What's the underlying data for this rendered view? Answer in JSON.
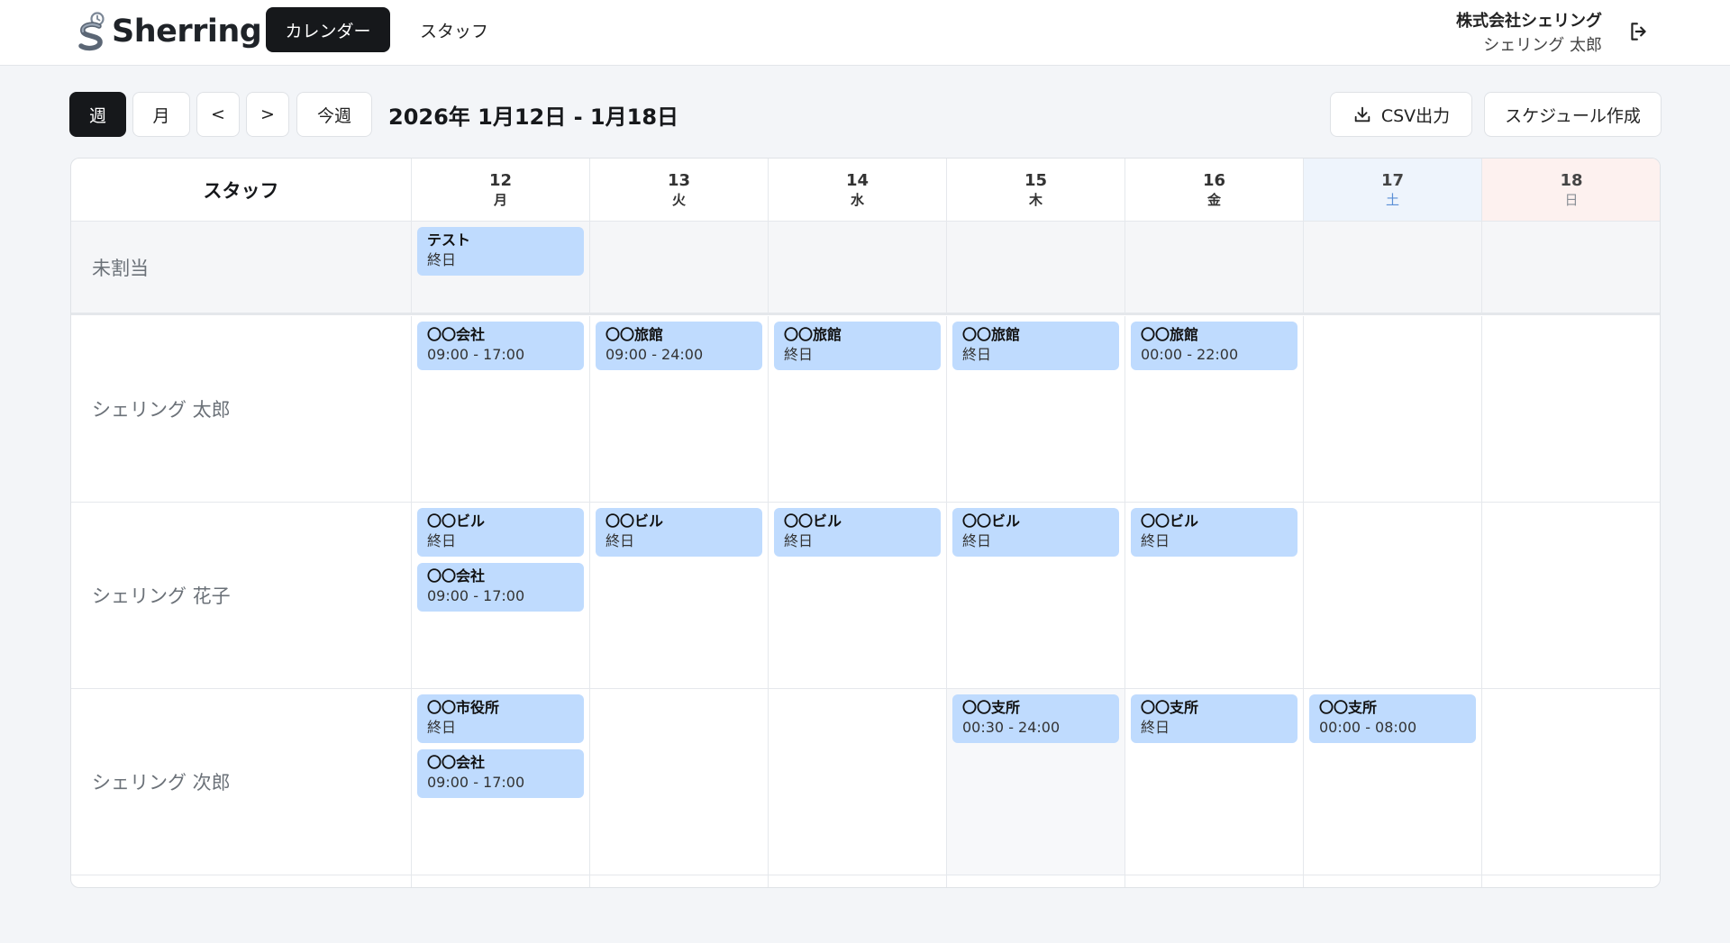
{
  "header": {
    "logo_text": "Sherring",
    "nav": {
      "calendar": "カレンダー",
      "staff": "スタッフ"
    },
    "user": {
      "company": "株式会社シェリング",
      "name": "シェリング 太郎"
    }
  },
  "toolbar": {
    "week": "週",
    "month": "月",
    "prev": "<",
    "next": ">",
    "this_week": "今週",
    "date_range": "2026年 1月12日 - 1月18日",
    "csv": "CSV出力",
    "create": "スケジュール作成"
  },
  "calendar": {
    "staff_header": "スタッフ",
    "days": [
      {
        "num": "12",
        "weekday": "月"
      },
      {
        "num": "13",
        "weekday": "火"
      },
      {
        "num": "14",
        "weekday": "水"
      },
      {
        "num": "15",
        "weekday": "木"
      },
      {
        "num": "16",
        "weekday": "金"
      },
      {
        "num": "17",
        "weekday": "土"
      },
      {
        "num": "18",
        "weekday": "日"
      }
    ],
    "rows": [
      {
        "label": "未割当",
        "cells": [
          [
            {
              "title": "テスト",
              "time": "終日"
            }
          ],
          [],
          [],
          [],
          [],
          [],
          []
        ]
      },
      {
        "label": "シェリング 太郎",
        "cells": [
          [
            {
              "title": "〇〇会社",
              "time": "09:00 - 17:00"
            }
          ],
          [
            {
              "title": "〇〇旅館",
              "time": "09:00 - 24:00"
            }
          ],
          [
            {
              "title": "〇〇旅館",
              "time": "終日"
            }
          ],
          [
            {
              "title": "〇〇旅館",
              "time": "終日"
            }
          ],
          [
            {
              "title": "〇〇旅館",
              "time": "00:00 - 22:00"
            }
          ],
          [],
          []
        ]
      },
      {
        "label": "シェリング 花子",
        "cells": [
          [
            {
              "title": "〇〇ビル",
              "time": "終日"
            },
            {
              "title": "〇〇会社",
              "time": "09:00 - 17:00"
            }
          ],
          [
            {
              "title": "〇〇ビル",
              "time": "終日"
            }
          ],
          [
            {
              "title": "〇〇ビル",
              "time": "終日"
            }
          ],
          [
            {
              "title": "〇〇ビル",
              "time": "終日"
            }
          ],
          [
            {
              "title": "〇〇ビル",
              "time": "終日"
            }
          ],
          [],
          []
        ]
      },
      {
        "label": "シェリング 次郎",
        "cells": [
          [
            {
              "title": "〇〇市役所",
              "time": "終日"
            },
            {
              "title": "〇〇会社",
              "time": "09:00 - 17:00"
            }
          ],
          [],
          [],
          [
            {
              "title": "〇〇支所",
              "time": "00:30 - 24:00"
            }
          ],
          [
            {
              "title": "〇〇支所",
              "time": "終日"
            }
          ],
          [
            {
              "title": "〇〇支所",
              "time": "00:00 - 08:00"
            }
          ],
          []
        ]
      }
    ]
  },
  "colors": {
    "primary": "#16181b",
    "event": "#bfdbfe",
    "saturday_bg": "#eef4fc",
    "sunday_bg": "#fdf1ef"
  }
}
